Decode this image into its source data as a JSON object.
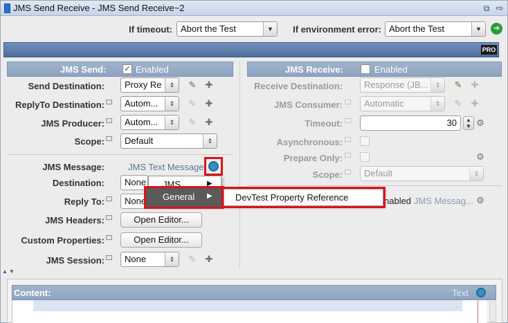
{
  "window": {
    "title": "JMS Send Receive - JMS Send Receive~2",
    "restore_glyph": "⧉",
    "popout_glyph": "⇨"
  },
  "top_options": {
    "timeout_label": "If timeout:",
    "timeout_value": "Abort the Test",
    "env_error_label": "If environment error:",
    "env_error_value": "Abort the Test",
    "go_glyph": "➔"
  },
  "banner": {
    "badge": "PRO"
  },
  "send": {
    "header": "JMS Send:",
    "enabled_label": "Enabled",
    "enabled": true,
    "send_destination_label": "Send Destination:",
    "send_destination_value": "Proxy Re",
    "replyto_label": "ReplyTo Destination:",
    "replyto_value": "Autom...",
    "producer_label": "JMS Producer:",
    "producer_value": "Autom...",
    "scope_label": "Scope:",
    "scope_value": "Default",
    "message_label": "JMS Message:",
    "message_value": "JMS Text Message",
    "destination_label": "Destination:",
    "destination_value": "None",
    "reply_to_label": "Reply To:",
    "reply_to_value": "None",
    "headers_label": "JMS Headers:",
    "headers_button": "Open Editor...",
    "custom_props_label": "Custom Properties:",
    "custom_props_button": "Open Editor...",
    "session_label": "JMS Session:",
    "session_value": "None"
  },
  "receive": {
    "header": "JMS Receive:",
    "enabled_label": "Enabled",
    "enabled": false,
    "receive_destination_label": "Receive Destination:",
    "receive_destination_value": "Response (JB...",
    "consumer_label": "JMS Consumer:",
    "consumer_value": "Automatic",
    "timeout_label": "Timeout:",
    "timeout_value": "30",
    "async_label": "Asynchronous:",
    "prepare_label": "Prepare Only:",
    "scope_label": "Scope:",
    "scope_value": "Default",
    "partial_enabled_label": "nabled",
    "partial_message_value": "JMS Messag..."
  },
  "context_menu": {
    "items": [
      {
        "label": "JMS",
        "has_submenu": true
      },
      {
        "label": "General",
        "has_submenu": true,
        "highlighted": true
      }
    ],
    "submenu_item": "DevTest Property Reference",
    "arrow_glyph": "▶"
  },
  "content": {
    "header": "Content:",
    "type_label": "Text"
  },
  "colors": {
    "header_blue": "#8da3c0",
    "banner_blue": "#5a79a8",
    "highlight_red": "#e0101a",
    "menu_highlight": "#5a5a5a",
    "go_green": "#2e9b3a"
  }
}
